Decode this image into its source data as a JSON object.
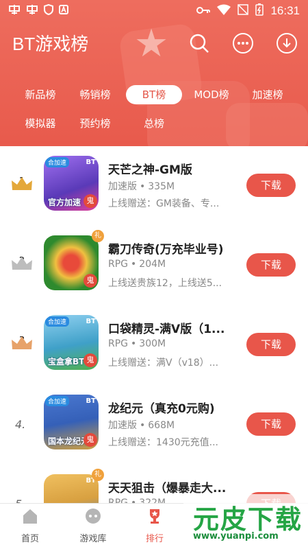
{
  "status_bar": {
    "left_icons": [
      "app-notify-icon",
      "app-notify-icon",
      "shield-icon",
      "a-icon"
    ],
    "time": "16:31"
  },
  "header": {
    "title": "BT游戏榜",
    "icons": [
      "search-icon",
      "message-icon",
      "download-icon"
    ],
    "tabs": [
      {
        "label": "新品榜",
        "active": false
      },
      {
        "label": "畅销榜",
        "active": false
      },
      {
        "label": "BT榜",
        "active": true
      },
      {
        "label": "MOD榜",
        "active": false
      },
      {
        "label": "加速榜",
        "active": false
      },
      {
        "label": "模拟器",
        "active": false
      },
      {
        "label": "预约榜",
        "active": false
      },
      {
        "label": "总榜",
        "active": false
      }
    ]
  },
  "list": {
    "download_label": "下载",
    "items": [
      {
        "rank": "1",
        "name": "天芒之神-GM版",
        "type": "加速版",
        "size": "335M",
        "desc": "上线赠送：GM装备、专...",
        "icon_tag": "合加速",
        "icon_label": "官方加速",
        "icon_color": "#7a5ad6"
      },
      {
        "rank": "2",
        "name": "霸刀传奇(万充毕业号)",
        "type": "RPG",
        "size": "204M",
        "desc": "上线送贵族12，上线送5...",
        "icon_tag": "",
        "icon_label": "",
        "icon_color": "#2e8a2e"
      },
      {
        "rank": "3",
        "name": "口袋精灵-满V版（1...",
        "type": "RPG",
        "size": "300M",
        "desc": "上线赠送：满V（v18）...",
        "icon_tag": "合加速",
        "icon_label": "宝盒拿BT",
        "icon_color": "#3fa0c8"
      },
      {
        "rank": "4.",
        "name": "龙纪元（真充0元购)",
        "type": "加速版",
        "size": "668M",
        "desc": "上线赠送：1430元充值...",
        "icon_tag": "合加速",
        "icon_label": "国本龙纪元",
        "icon_color": "#3560b8"
      },
      {
        "rank": "5",
        "name": "天天狙击（爆暴走大...",
        "type": "RPG",
        "size": "322M",
        "desc": "",
        "icon_tag": "",
        "icon_label": "",
        "icon_color": "#d8a040"
      }
    ]
  },
  "bottom_nav": [
    {
      "label": "首页",
      "icon": "home-icon",
      "active": false
    },
    {
      "label": "游戏库",
      "icon": "gamepad-icon",
      "active": false
    },
    {
      "label": "排行",
      "icon": "trophy-icon",
      "active": true
    }
  ],
  "watermark": {
    "text": "元皮下载",
    "url": "www.yuanpi.com"
  },
  "colors": {
    "header": "#ec6557",
    "accent": "#e8564a",
    "gold": "#e4a83a",
    "silver": "#bdbdbd",
    "bronze": "#e7a26a"
  }
}
